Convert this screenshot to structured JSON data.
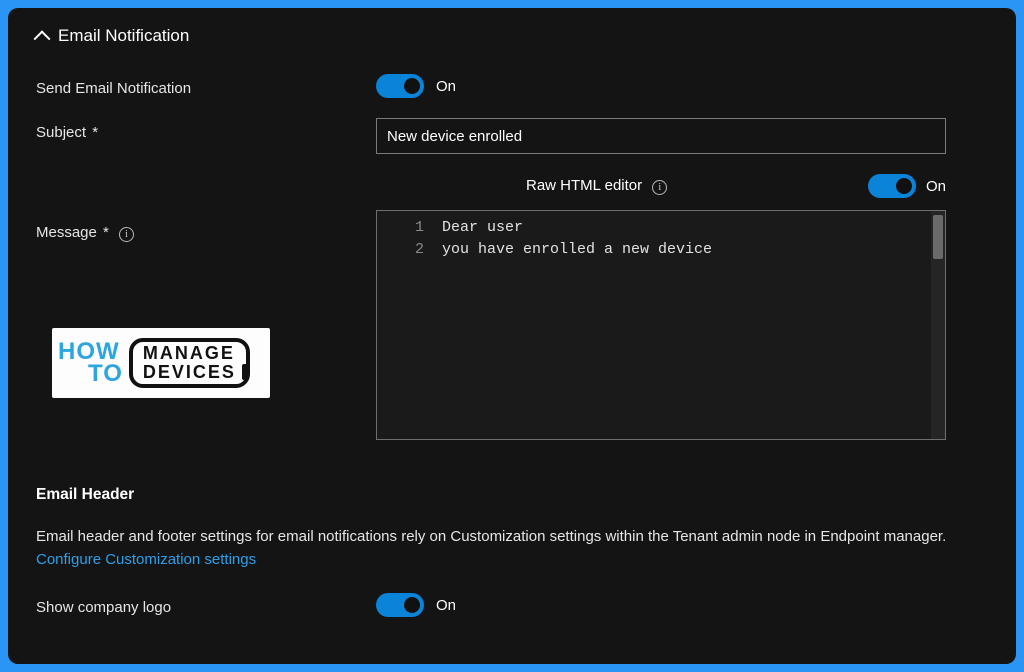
{
  "section_title": "Email Notification",
  "fields": {
    "send_email_label": "Send Email Notification",
    "subject_label": "Subject",
    "message_label": "Message",
    "required_mark": "*"
  },
  "toggles": {
    "send_email": {
      "state_label": "On"
    },
    "raw_html": {
      "header_label": "Raw HTML editor",
      "state_label": "On"
    },
    "company_logo": {
      "state_label": "On"
    }
  },
  "subject_value": "New device enrolled",
  "message_lines": {
    "l1_num": "1",
    "l1_text": "Dear user",
    "l2_num": "2",
    "l2_text": "you have enrolled a new device"
  },
  "logo": {
    "how": "HOW",
    "to": "TO",
    "manage": "MANAGE",
    "devices": "DEVICES"
  },
  "email_header": {
    "title": "Email Header",
    "desc_part1": "Email header and footer settings for email notifications rely on Customization settings within the Tenant admin node in Endpoint manager. ",
    "link_text": "Configure Customization settings",
    "show_logo_label": "Show company logo"
  }
}
